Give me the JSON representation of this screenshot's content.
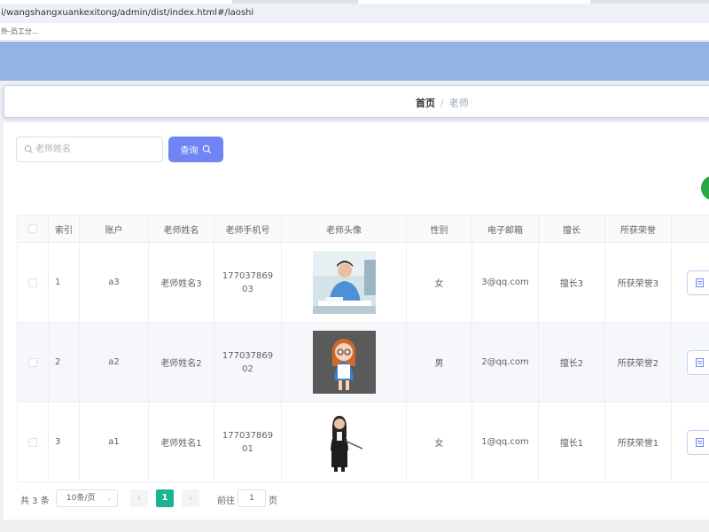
{
  "browser": {
    "url": "i/wangshangxuankexitong/admin/dist/index.html#/laoshi",
    "bookmark": "外-员工分..."
  },
  "breadcrumb": {
    "home": "首页",
    "separator": "/",
    "current": "老师"
  },
  "search": {
    "placeholder": "老师姓名",
    "button_label": "查询"
  },
  "table": {
    "columns": [
      "",
      "索引",
      "账户",
      "老师姓名",
      "老师手机号",
      "老师头像",
      "性别",
      "电子邮箱",
      "擅长",
      "所获荣誉",
      ""
    ],
    "rows": [
      {
        "index": "1",
        "account": "a3",
        "name": "老师姓名3",
        "phone": "17703786903",
        "avatar": "male-teacher-at-desk",
        "gender": "女",
        "email": "3@qq.com",
        "skill": "擅长3",
        "honor": "所获荣誉3"
      },
      {
        "index": "2",
        "account": "a2",
        "name": "老师姓名2",
        "phone": "17703786902",
        "avatar": "cartoon-female-teacher",
        "gender": "男",
        "email": "2@qq.com",
        "skill": "擅长2",
        "honor": "所获荣誉2"
      },
      {
        "index": "3",
        "account": "a1",
        "name": "老师姓名1",
        "phone": "17703786901",
        "avatar": "female-teacher-with-pointer",
        "gender": "女",
        "email": "1@qq.com",
        "skill": "擅长1",
        "honor": "所获荣誉1"
      }
    ]
  },
  "pagination": {
    "total": "共 3 条",
    "page_size": "10条/页",
    "prev": "‹",
    "next": "›",
    "current_page": "1",
    "goto_label": "前往",
    "goto_value": "1",
    "page_suffix": "页"
  },
  "colors": {
    "top_band": "#93b4e2",
    "primary": "#7085f5",
    "page_active": "#1ab394",
    "dot": "#28a745"
  }
}
